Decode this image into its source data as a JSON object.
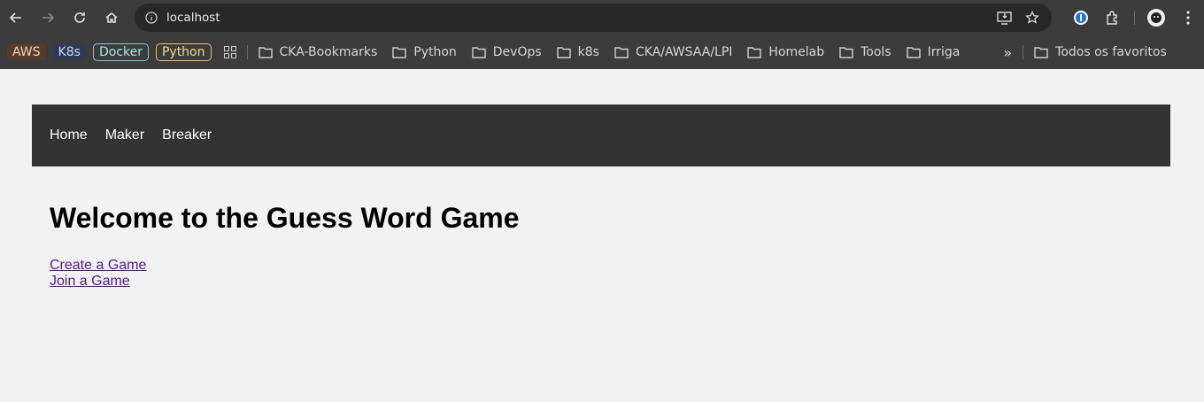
{
  "browser": {
    "url": "localhost",
    "bookmark_chips": [
      "AWS",
      "K8s",
      "Docker",
      "Python"
    ],
    "bookmark_folders": [
      "CKA-Bookmarks",
      "Python",
      "DevOps",
      "k8s",
      "CKA/AWSAA/LPI",
      "Homelab",
      "Tools",
      "Irriga"
    ],
    "overflow_label": "»",
    "all_bookmarks": "Todos os favoritos"
  },
  "site": {
    "nav": [
      "Home",
      "Maker",
      "Breaker"
    ],
    "heading": "Welcome to the Guess Word Game",
    "links": [
      "Create a Game",
      "Join a Game"
    ]
  }
}
